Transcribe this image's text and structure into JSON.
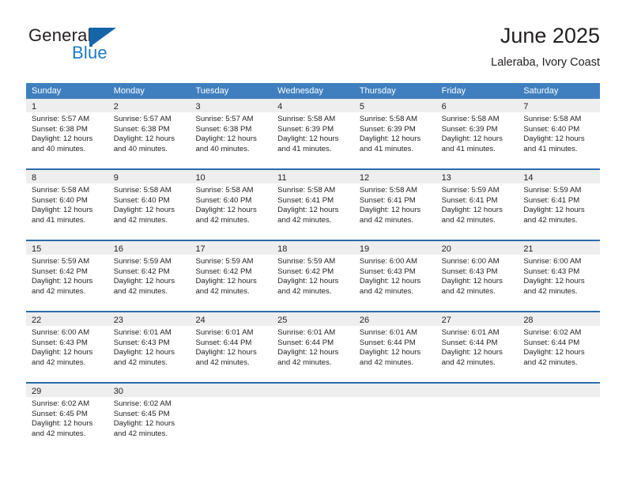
{
  "brand": {
    "name_part1": "General",
    "name_part2": "Blue",
    "accent_color": "#1c7bc4",
    "flag_icon": "triangle-flag-icon"
  },
  "header": {
    "title": "June 2025",
    "subtitle": "Laleraba, Ivory Coast"
  },
  "theme": {
    "header_bg": "#3f7fbf",
    "row_border": "#2b6cab",
    "day_band_bg": "#eeeeee",
    "text_color": "#231f20"
  },
  "weekdays": [
    "Sunday",
    "Monday",
    "Tuesday",
    "Wednesday",
    "Thursday",
    "Friday",
    "Saturday"
  ],
  "weeks": [
    [
      {
        "day": "1",
        "sunrise": "Sunrise: 5:57 AM",
        "sunset": "Sunset: 6:38 PM",
        "daylight": "Daylight: 12 hours and 40 minutes."
      },
      {
        "day": "2",
        "sunrise": "Sunrise: 5:57 AM",
        "sunset": "Sunset: 6:38 PM",
        "daylight": "Daylight: 12 hours and 40 minutes."
      },
      {
        "day": "3",
        "sunrise": "Sunrise: 5:57 AM",
        "sunset": "Sunset: 6:38 PM",
        "daylight": "Daylight: 12 hours and 40 minutes."
      },
      {
        "day": "4",
        "sunrise": "Sunrise: 5:58 AM",
        "sunset": "Sunset: 6:39 PM",
        "daylight": "Daylight: 12 hours and 41 minutes."
      },
      {
        "day": "5",
        "sunrise": "Sunrise: 5:58 AM",
        "sunset": "Sunset: 6:39 PM",
        "daylight": "Daylight: 12 hours and 41 minutes."
      },
      {
        "day": "6",
        "sunrise": "Sunrise: 5:58 AM",
        "sunset": "Sunset: 6:39 PM",
        "daylight": "Daylight: 12 hours and 41 minutes."
      },
      {
        "day": "7",
        "sunrise": "Sunrise: 5:58 AM",
        "sunset": "Sunset: 6:40 PM",
        "daylight": "Daylight: 12 hours and 41 minutes."
      }
    ],
    [
      {
        "day": "8",
        "sunrise": "Sunrise: 5:58 AM",
        "sunset": "Sunset: 6:40 PM",
        "daylight": "Daylight: 12 hours and 41 minutes."
      },
      {
        "day": "9",
        "sunrise": "Sunrise: 5:58 AM",
        "sunset": "Sunset: 6:40 PM",
        "daylight": "Daylight: 12 hours and 42 minutes."
      },
      {
        "day": "10",
        "sunrise": "Sunrise: 5:58 AM",
        "sunset": "Sunset: 6:40 PM",
        "daylight": "Daylight: 12 hours and 42 minutes."
      },
      {
        "day": "11",
        "sunrise": "Sunrise: 5:58 AM",
        "sunset": "Sunset: 6:41 PM",
        "daylight": "Daylight: 12 hours and 42 minutes."
      },
      {
        "day": "12",
        "sunrise": "Sunrise: 5:58 AM",
        "sunset": "Sunset: 6:41 PM",
        "daylight": "Daylight: 12 hours and 42 minutes."
      },
      {
        "day": "13",
        "sunrise": "Sunrise: 5:59 AM",
        "sunset": "Sunset: 6:41 PM",
        "daylight": "Daylight: 12 hours and 42 minutes."
      },
      {
        "day": "14",
        "sunrise": "Sunrise: 5:59 AM",
        "sunset": "Sunset: 6:41 PM",
        "daylight": "Daylight: 12 hours and 42 minutes."
      }
    ],
    [
      {
        "day": "15",
        "sunrise": "Sunrise: 5:59 AM",
        "sunset": "Sunset: 6:42 PM",
        "daylight": "Daylight: 12 hours and 42 minutes."
      },
      {
        "day": "16",
        "sunrise": "Sunrise: 5:59 AM",
        "sunset": "Sunset: 6:42 PM",
        "daylight": "Daylight: 12 hours and 42 minutes."
      },
      {
        "day": "17",
        "sunrise": "Sunrise: 5:59 AM",
        "sunset": "Sunset: 6:42 PM",
        "daylight": "Daylight: 12 hours and 42 minutes."
      },
      {
        "day": "18",
        "sunrise": "Sunrise: 5:59 AM",
        "sunset": "Sunset: 6:42 PM",
        "daylight": "Daylight: 12 hours and 42 minutes."
      },
      {
        "day": "19",
        "sunrise": "Sunrise: 6:00 AM",
        "sunset": "Sunset: 6:43 PM",
        "daylight": "Daylight: 12 hours and 42 minutes."
      },
      {
        "day": "20",
        "sunrise": "Sunrise: 6:00 AM",
        "sunset": "Sunset: 6:43 PM",
        "daylight": "Daylight: 12 hours and 42 minutes."
      },
      {
        "day": "21",
        "sunrise": "Sunrise: 6:00 AM",
        "sunset": "Sunset: 6:43 PM",
        "daylight": "Daylight: 12 hours and 42 minutes."
      }
    ],
    [
      {
        "day": "22",
        "sunrise": "Sunrise: 6:00 AM",
        "sunset": "Sunset: 6:43 PM",
        "daylight": "Daylight: 12 hours and 42 minutes."
      },
      {
        "day": "23",
        "sunrise": "Sunrise: 6:01 AM",
        "sunset": "Sunset: 6:43 PM",
        "daylight": "Daylight: 12 hours and 42 minutes."
      },
      {
        "day": "24",
        "sunrise": "Sunrise: 6:01 AM",
        "sunset": "Sunset: 6:44 PM",
        "daylight": "Daylight: 12 hours and 42 minutes."
      },
      {
        "day": "25",
        "sunrise": "Sunrise: 6:01 AM",
        "sunset": "Sunset: 6:44 PM",
        "daylight": "Daylight: 12 hours and 42 minutes."
      },
      {
        "day": "26",
        "sunrise": "Sunrise: 6:01 AM",
        "sunset": "Sunset: 6:44 PM",
        "daylight": "Daylight: 12 hours and 42 minutes."
      },
      {
        "day": "27",
        "sunrise": "Sunrise: 6:01 AM",
        "sunset": "Sunset: 6:44 PM",
        "daylight": "Daylight: 12 hours and 42 minutes."
      },
      {
        "day": "28",
        "sunrise": "Sunrise: 6:02 AM",
        "sunset": "Sunset: 6:44 PM",
        "daylight": "Daylight: 12 hours and 42 minutes."
      }
    ],
    [
      {
        "day": "29",
        "sunrise": "Sunrise: 6:02 AM",
        "sunset": "Sunset: 6:45 PM",
        "daylight": "Daylight: 12 hours and 42 minutes."
      },
      {
        "day": "30",
        "sunrise": "Sunrise: 6:02 AM",
        "sunset": "Sunset: 6:45 PM",
        "daylight": "Daylight: 12 hours and 42 minutes."
      },
      {
        "day": "",
        "sunrise": "",
        "sunset": "",
        "daylight": ""
      },
      {
        "day": "",
        "sunrise": "",
        "sunset": "",
        "daylight": ""
      },
      {
        "day": "",
        "sunrise": "",
        "sunset": "",
        "daylight": ""
      },
      {
        "day": "",
        "sunrise": "",
        "sunset": "",
        "daylight": ""
      },
      {
        "day": "",
        "sunrise": "",
        "sunset": "",
        "daylight": ""
      }
    ]
  ]
}
